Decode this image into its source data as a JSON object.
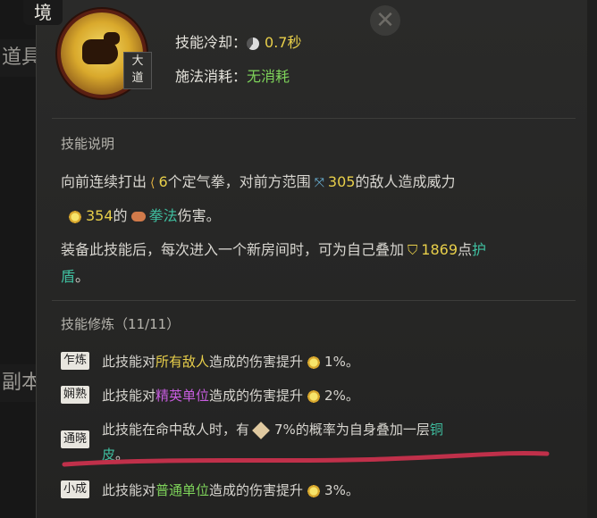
{
  "side": {
    "tab1": "道具",
    "tab2": "副本",
    "top_label": "境"
  },
  "skill": {
    "rank_badge": "大\n道",
    "cooldown_label": "技能冷却：",
    "cooldown_value": "0.7秒",
    "cost_label": "施法消耗：",
    "cost_value": "无消耗"
  },
  "desc": {
    "heading": "技能说明",
    "l1_a": "向前连续打出",
    "l1_count": "6",
    "l1_b": "个定气拳，对前方范围",
    "l1_range": "305",
    "l1_c": "的敌人造成威力",
    "l2_power": "354",
    "l2_a": "的",
    "l2_type": "拳法",
    "l2_b": "伤害。",
    "l3_a": "装备此技能后，每次进入一个新房间时，可为自己叠加",
    "l3_shield": "1869",
    "l3_b": "点",
    "l3_c": "护",
    "l4_a": "盾",
    "l4_b": "。"
  },
  "train": {
    "heading": "技能修炼（11/11）",
    "items": [
      {
        "tag": "乍炼",
        "a": "此技能对",
        "target": "所有敌人",
        "b": "造成的伤害提升",
        "val": "1%。"
      },
      {
        "tag": "娴熟",
        "a": "此技能对",
        "target": "精英单位",
        "b": "造成的伤害提升",
        "val": "2%。"
      },
      {
        "tag": "通晓",
        "a": "此技能在命中敌人时，有",
        "val": "7%",
        "b": "的概率为自身叠加一层",
        "target": "铜",
        "target2": "皮",
        "c": "。"
      },
      {
        "tag": "小成",
        "a": "此技能对",
        "target": "普通单位",
        "b": "造成的伤害提升",
        "val": "3%。"
      }
    ]
  },
  "colors": {
    "yellow": "#e8cf4a",
    "green": "#7ed35a",
    "purple": "#c85de0",
    "teal": "#3fbfa0",
    "underline": "#c0304a"
  },
  "icons": [
    "close-icon",
    "fist-icon",
    "cooldown-icon",
    "sun-icon",
    "wave-icon",
    "range-icon",
    "shield-icon",
    "scroll-icon"
  ]
}
